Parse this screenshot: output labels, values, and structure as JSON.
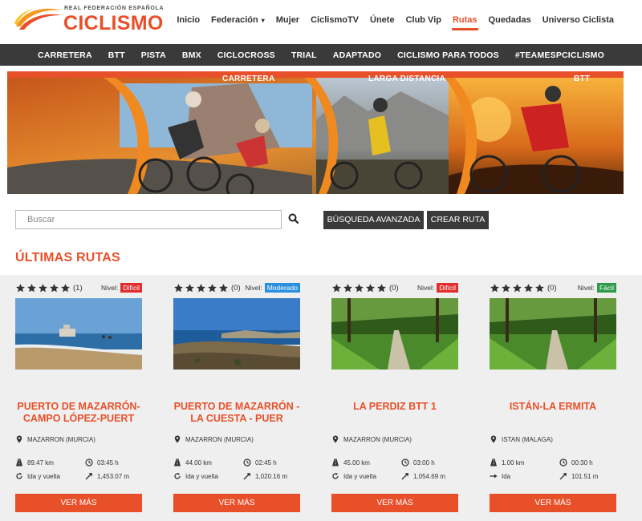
{
  "logo": {
    "subtitle": "REAL FEDERACIÓN ESPAÑOLA",
    "title": "CICLISMO"
  },
  "topnav": [
    {
      "label": "Inicio",
      "active": false
    },
    {
      "label": "Federación",
      "active": false,
      "dropdown": true
    },
    {
      "label": "Mujer",
      "active": false
    },
    {
      "label": "CiclismoTV",
      "active": false
    },
    {
      "label": "Únete",
      "active": false
    },
    {
      "label": "Club Vip",
      "active": false
    },
    {
      "label": "Rutas",
      "active": true
    },
    {
      "label": "Quedadas",
      "active": false
    },
    {
      "label": "Universo Ciclista",
      "active": false
    }
  ],
  "categories": [
    "CARRETERA",
    "BTT",
    "PISTA",
    "BMX",
    "CICLOCROSS",
    "TRIAL",
    "ADAPTADO",
    "CICLISMO PARA TODOS",
    "#TEAMESPCICLISMO"
  ],
  "banner": {
    "labels": [
      "CARRETERA",
      "LARGA DISTANCIA",
      "BTT"
    ]
  },
  "search": {
    "placeholder": "Buscar",
    "advanced_label": "BÚSQUEDA AVANZADA",
    "create_label": "CREAR RUTA"
  },
  "section_title": "ÚLTIMAS RUTAS",
  "level_label": "Nivel:",
  "more_label": "VER MÁS",
  "colors": {
    "accent": "#e8502a",
    "dark": "#3a3a3a",
    "dificil": "#e02e2e",
    "moderado": "#2b8fe0",
    "facil": "#2e9a4a"
  },
  "routes": [
    {
      "stars": 5,
      "count": "(1)",
      "level": "Difícil",
      "level_color": "#e02e2e",
      "image": "beach",
      "title_1": "PUERTO DE MAZARRÓN-",
      "title_2": "CAMPO LÓPEZ-PUERT",
      "location": "MAZARRON (MURCIA)",
      "distance": "89.47 km",
      "duration": "03:45 h",
      "type": "Ida y vuelta",
      "elevation": "1,453.07 m"
    },
    {
      "stars": 5,
      "count": "(0)",
      "level": "Moderado",
      "level_color": "#2b8fe0",
      "image": "coast",
      "title_1": "PUERTO DE MAZARRÓN -",
      "title_2": "LA CUESTA - PUER",
      "location": "MAZARRON (MURCIA)",
      "distance": "44.00 km",
      "duration": "02:45 h",
      "type": "Ida y vuelta",
      "elevation": "1,020.16 m"
    },
    {
      "stars": 5,
      "count": "(0)",
      "level": "Difícil",
      "level_color": "#e02e2e",
      "image": "forest",
      "title_1": "LA PERDIZ BTT 1",
      "title_2": "",
      "location": "MAZARRON (MURCIA)",
      "distance": "45.00 km",
      "duration": "03:00 h",
      "type": "Ida y vuelta",
      "elevation": "1,054.69 m"
    },
    {
      "stars": 5,
      "count": "(0)",
      "level": "Fácil",
      "level_color": "#2e9a4a",
      "image": "forest",
      "title_1": "ISTÁN-LA ERMITA",
      "title_2": "",
      "location": "ISTAN (MALAGA)",
      "distance": "1.00 km",
      "duration": "00:30 h",
      "type": "Ida",
      "elevation": "101.51 m"
    }
  ]
}
